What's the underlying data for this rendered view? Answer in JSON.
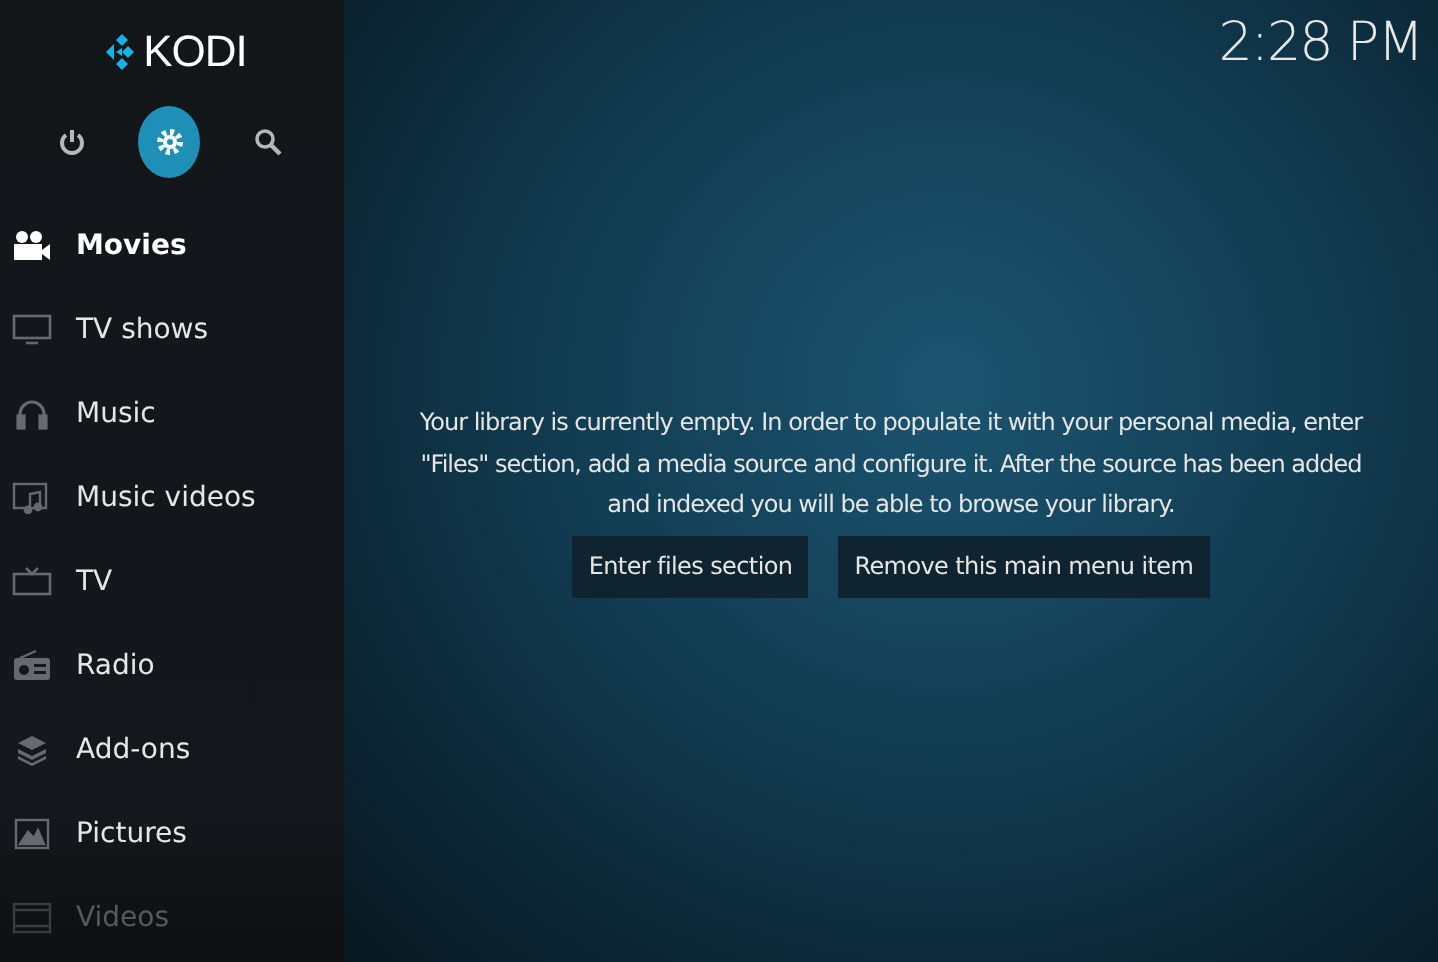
{
  "logo": {
    "text": "KODI"
  },
  "top_buttons": [
    {
      "kind": "power",
      "selected": false
    },
    {
      "kind": "settings",
      "selected": true
    },
    {
      "kind": "search",
      "selected": false
    }
  ],
  "menu": [
    {
      "kind": "movies",
      "label": "Movies",
      "selected": true,
      "dimmed": false
    },
    {
      "kind": "tvshows",
      "label": "TV shows",
      "selected": false,
      "dimmed": false
    },
    {
      "kind": "music",
      "label": "Music",
      "selected": false,
      "dimmed": false
    },
    {
      "kind": "musicvideos",
      "label": "Music videos",
      "selected": false,
      "dimmed": false
    },
    {
      "kind": "tv",
      "label": "TV",
      "selected": false,
      "dimmed": false
    },
    {
      "kind": "radio",
      "label": "Radio",
      "selected": false,
      "dimmed": false
    },
    {
      "kind": "addons",
      "label": "Add-ons",
      "selected": false,
      "dimmed": false
    },
    {
      "kind": "pictures",
      "label": "Pictures",
      "selected": false,
      "dimmed": false
    },
    {
      "kind": "videos",
      "label": "Videos",
      "selected": false,
      "dimmed": true
    }
  ],
  "clock": "2:28 PM",
  "message": "Your library is currently empty. In order to populate it with your personal media, enter \"Files\" section, add a media source and configure it. After the source has been added and indexed you will be able to browse your library.",
  "buttons": [
    "Enter files section",
    "Remove this main menu item"
  ]
}
